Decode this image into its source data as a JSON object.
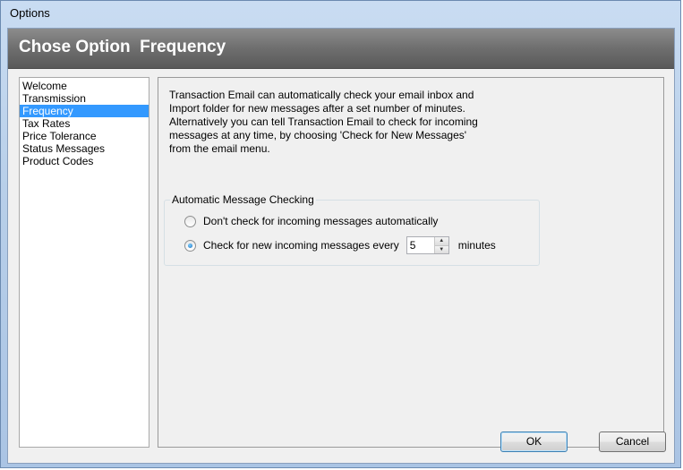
{
  "window": {
    "title": "Options"
  },
  "header": {
    "title": "Chose Option  Frequency"
  },
  "nav": {
    "items": [
      {
        "label": "Welcome",
        "selected": false
      },
      {
        "label": "Transmission",
        "selected": false
      },
      {
        "label": "Frequency",
        "selected": true
      },
      {
        "label": "Tax Rates",
        "selected": false
      },
      {
        "label": "Price Tolerance",
        "selected": false
      },
      {
        "label": "Status Messages",
        "selected": false
      },
      {
        "label": "Product Codes",
        "selected": false
      }
    ]
  },
  "content": {
    "description": "Transaction Email can automatically check your email inbox and\nImport folder for new messages after a set number of minutes.\nAlternatively you can tell Transaction Email to check for incoming\nmessages at any time, by choosing 'Check for New Messages'\nfrom the email menu.",
    "group": {
      "legend": "Automatic Message Checking",
      "option_manual": "Don't check for incoming messages automatically",
      "option_auto": "Check for new incoming messages every",
      "interval_value": "5",
      "interval_unit": "minutes",
      "selected_option": "auto"
    }
  },
  "buttons": {
    "ok": "OK",
    "cancel": "Cancel"
  },
  "colors": {
    "selection": "#3399ff",
    "header_band": "#6e6e6e"
  }
}
